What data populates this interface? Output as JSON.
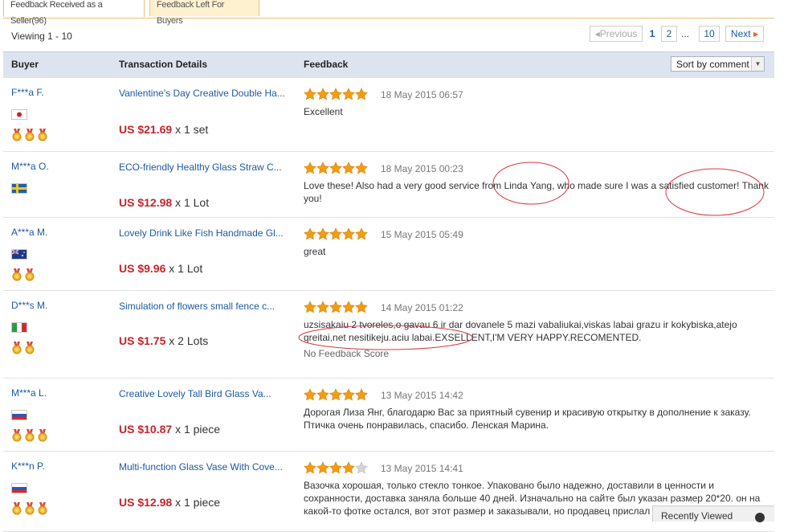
{
  "tabs": [
    {
      "label": "Feedback Received as a Seller(96)"
    },
    {
      "label": "Feedback Left For Buyers"
    }
  ],
  "viewing": "Viewing 1 - 10",
  "pager": {
    "previous": "Previous",
    "pages": [
      "1",
      "2",
      "...",
      "10"
    ],
    "next": "Next"
  },
  "columns": {
    "buyer": "Buyer",
    "transaction": "Transaction Details",
    "feedback": "Feedback"
  },
  "sort": {
    "selected": "Sort by comment"
  },
  "rows": [
    {
      "buyer": "F***a F.",
      "flag": "jp",
      "medals": 3,
      "item": "Vanlentine's Day Creative Double Ha...",
      "price": "US $21.69",
      "qty": "x 1 set",
      "stars": 5,
      "date": "18 May 2015 06:57",
      "feedback": "Excellent"
    },
    {
      "buyer": "M***a O.",
      "flag": "se",
      "medals": 0,
      "item": "ECO-friendly Healthy Glass Straw C...",
      "price": "US $12.98",
      "qty": "x 1 Lot",
      "stars": 5,
      "date": "18 May 2015 00:23",
      "feedback": "Love these! Also had a very good service from Linda Yang, who made sure I was a satisfied customer! Thank you!"
    },
    {
      "buyer": "A***a M.",
      "flag": "au",
      "medals": 2,
      "item": "Lovely Drink Like Fish Handmade Gl...",
      "price": "US $9.96",
      "qty": "x 1 Lot",
      "stars": 5,
      "date": "15 May 2015 05:49",
      "feedback": "great"
    },
    {
      "buyer": "D***s M.",
      "flag": "it",
      "medals": 2,
      "item": "Simulation of flowers small fence c...",
      "price": "US $1.75",
      "qty": "x 2 Lots",
      "stars": 5,
      "date": "14 May 2015 01:22",
      "feedback": "uzsisakaiu 2 tvoreles,o gavau 6 ir dar dovanele 5 mazi vabaliukai,viskas labai grazu ir kokybiska,atejo greitai,net nesitikeju.aciu labai.EXSELLENT,I'M VERY HAPPY.RECOMENTED.",
      "note": "No Feedback Score"
    },
    {
      "buyer": "M***a L.",
      "flag": "ru",
      "medals": 3,
      "item": "Creative Lovely Tall Bird Glass Va...",
      "price": "US $10.87",
      "qty": "x 1 piece",
      "stars": 5,
      "date": "13 May 2015 14:42",
      "feedback": "Дорогая Лиза Янг, благодарю Вас за приятный сувенир и красивую открытку в дополнение к заказу. Птичка очень понравилась, спасибо. Ленская Марина."
    },
    {
      "buyer": "K***n P.",
      "flag": "ru",
      "medals": 3,
      "item": "Multi-function Glass Vase With Cove...",
      "price": "US $12.98",
      "qty": "x 1 piece",
      "stars": 4,
      "date": "13 May 2015 14:41",
      "feedback": "Вазочка хорошая, только стекло тонкое. Упаковано было надежно, доставили в ценности и сохранности, доставка заняла больше 40 дней. Изначально на сайте был указан размер 20*20. он на какой-то фотке остался, вот этот размер и заказывали, но продавец прислал"
    }
  ],
  "recently_viewed": "Recently Viewed",
  "colors": {
    "link": "#1b59a3",
    "price": "#c3252b",
    "star": "#f39c12",
    "header_bg": "#dde3ef",
    "annotation": "#d9363e"
  }
}
